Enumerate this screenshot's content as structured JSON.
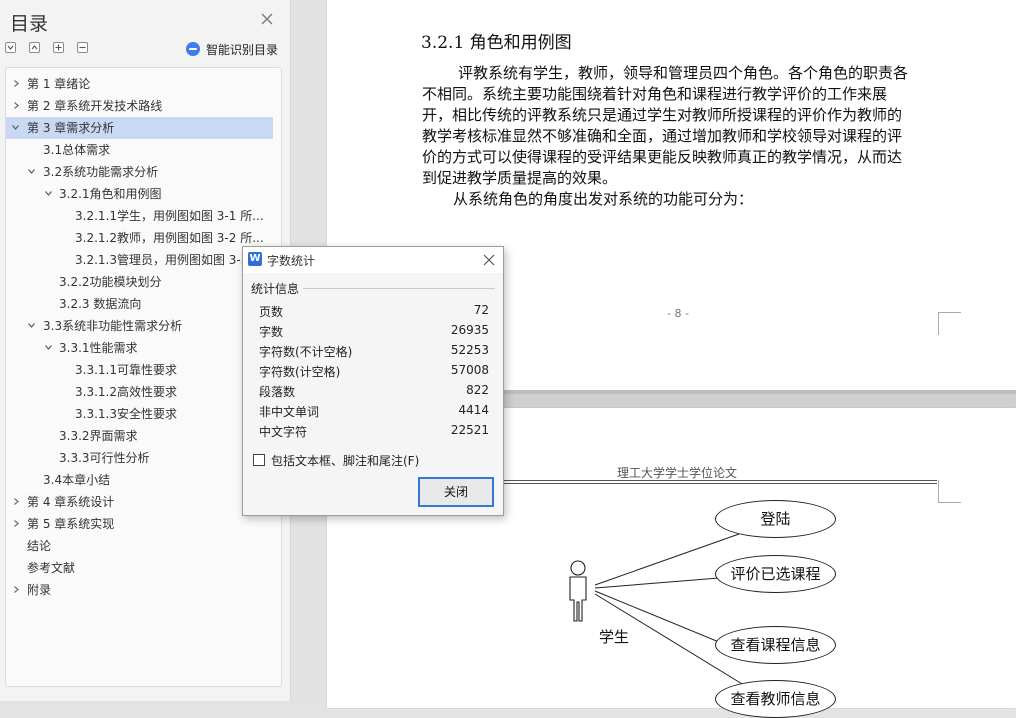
{
  "sidebar": {
    "title": "目录",
    "smart_toc_label": "智能识别目录",
    "toc": [
      {
        "label": "第 1 章绪论"
      },
      {
        "label": "第 2 章系统开发技术路线"
      },
      {
        "label": "第 3 章需求分析"
      },
      {
        "label": "3.1总体需求"
      },
      {
        "label": "3.2系统功能需求分析"
      },
      {
        "label": "3.2.1角色和用例图"
      },
      {
        "label": "3.2.1.1学生，用例图如图 3-1 所..."
      },
      {
        "label": "3.2.1.2教师，用例图如图 3-2 所..."
      },
      {
        "label": "3.2.1.3管理员，用例图如图 3-3"
      },
      {
        "label": "3.2.2功能模块划分"
      },
      {
        "label": "3.2.3  数据流向"
      },
      {
        "label": "3.3系统非功能性需求分析"
      },
      {
        "label": "3.3.1性能需求"
      },
      {
        "label": "3.3.1.1可靠性要求"
      },
      {
        "label": "3.3.1.2高效性要求"
      },
      {
        "label": "3.3.1.3安全性要求"
      },
      {
        "label": "3.3.2界面需求"
      },
      {
        "label": "3.3.3可行性分析"
      },
      {
        "label": "3.4本章小结"
      },
      {
        "label": "第 4 章系统设计"
      },
      {
        "label": "第 5 章系统实现"
      },
      {
        "label": "结论"
      },
      {
        "label": "参考文献"
      },
      {
        "label": "附录"
      }
    ]
  },
  "document": {
    "heading": "3.2.1  角色和用例图",
    "paragraph_lines": [
      "评教系统有学生，教师，领导和管理员四个角色。各个角色的职责各",
      "不相同。系统主要功能围绕着针对角色和课程进行教学评价的工作来展",
      "开，相比传统的评教系统只是通过学生对教师所授课程的评价作为教师的",
      "教学考核标准显然不够准确和全面，通过增加教师和学校领导对课程的评",
      "价的方式可以使得课程的受评结果更能反映教师真正的教学情况，从而达",
      "到促进教学质量提高的效果。"
    ],
    "paragraph2": "从系统角色的角度出发对系统的功能可分为：",
    "page_number": "- 8 -",
    "page2_header": "理工大学学士学位论文",
    "diagram": {
      "actor": "学生",
      "use_cases": [
        "登陆",
        "评价已选课程",
        "查看课程信息",
        "查看教师信息"
      ]
    }
  },
  "dialog": {
    "title": "字数统计",
    "section": "统计信息",
    "stats": [
      {
        "label": "页数",
        "value": "72"
      },
      {
        "label": "字数",
        "value": "26935"
      },
      {
        "label": "字符数(不计空格)",
        "value": "52253"
      },
      {
        "label": "字符数(计空格)",
        "value": "57008"
      },
      {
        "label": "段落数",
        "value": "822"
      },
      {
        "label": "非中文单词",
        "value": "4414"
      },
      {
        "label": "中文字符",
        "value": "22521"
      }
    ],
    "checkbox_label": "包括文本框、脚注和尾注(F)",
    "checkbox_checked": false,
    "close_button": "关闭"
  },
  "colors": {
    "accent": "#3578d5",
    "selection": "#c9d9f4"
  }
}
